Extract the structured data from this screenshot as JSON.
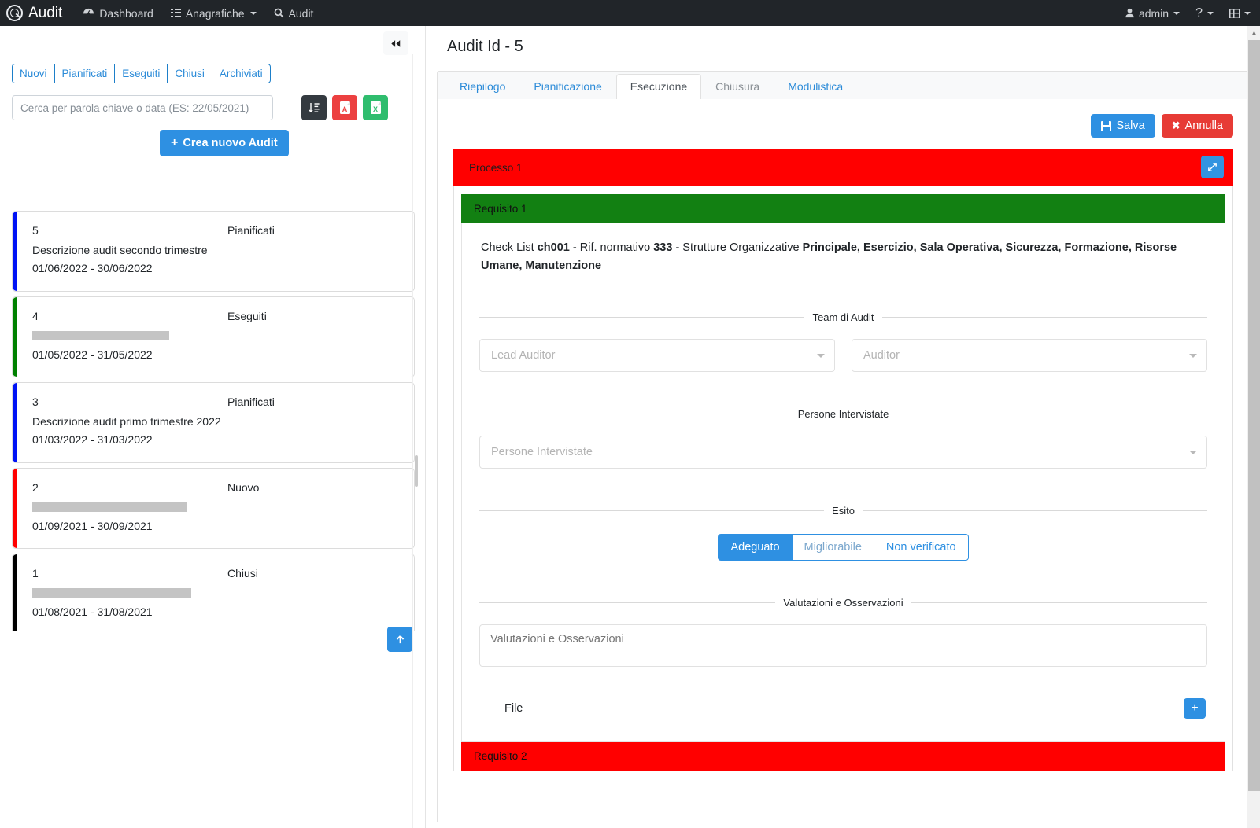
{
  "navbar": {
    "brand": "Audit",
    "brand_icon": "magnifier-logo-icon",
    "links": [
      {
        "label": "Dashboard",
        "icon": "dashboard-icon"
      },
      {
        "label": "Anagrafiche",
        "icon": "list-icon",
        "caret": true
      },
      {
        "label": "Audit",
        "icon": "search-icon"
      }
    ],
    "user": "admin",
    "help": "?",
    "apps_icon": "grid-icon"
  },
  "sidebar": {
    "collapse_icon": "double-chevron-left-icon",
    "filters": [
      {
        "label": "Nuovi"
      },
      {
        "label": "Pianificati"
      },
      {
        "label": "Eseguiti"
      },
      {
        "label": "Chiusi"
      },
      {
        "label": "Archiviati"
      }
    ],
    "search": {
      "placeholder": "Cerca per parola chiave o data (ES: 22/05/2021)",
      "value": ""
    },
    "tools": [
      {
        "name": "sort-button",
        "icon": "sort-amount-down-icon"
      },
      {
        "name": "export-pdf-button",
        "icon": "file-pdf-icon",
        "letter": "A"
      },
      {
        "name": "export-excel-button",
        "icon": "file-excel-icon",
        "letter": "X"
      }
    ],
    "create_button": "Crea nuovo Audit",
    "create_button_icon": "plus-icon",
    "scroll_top_icon": "arrow-up-icon",
    "cards": [
      {
        "id": "5",
        "status": "Pianificati",
        "description": "Descrizione audit secondo trimestre",
        "redacted": false,
        "redacted_width": 0,
        "dates": "01/06/2022 - 30/06/2022",
        "stripe": "#0013f5"
      },
      {
        "id": "4",
        "status": "Eseguiti",
        "description": "",
        "redacted": true,
        "redacted_width": 174,
        "dates": "01/05/2022 - 31/05/2022",
        "stripe": "#008000"
      },
      {
        "id": "3",
        "status": "Pianificati",
        "description": "Descrizione audit primo trimestre 2022",
        "redacted": false,
        "redacted_width": 0,
        "dates": "01/03/2022 - 31/03/2022",
        "stripe": "#0013f5"
      },
      {
        "id": "2",
        "status": "Nuovo",
        "description": "",
        "redacted": true,
        "redacted_width": 197,
        "dates": "01/09/2021 - 30/09/2021",
        "stripe": "#ff0000"
      },
      {
        "id": "1",
        "status": "Chiusi",
        "description": "",
        "redacted": true,
        "redacted_width": 202,
        "dates": "01/08/2021 - 31/08/2021",
        "stripe": "#000000"
      }
    ]
  },
  "main": {
    "title": "Audit Id - 5",
    "tabs": [
      {
        "label": "Riepilogo",
        "state": "link"
      },
      {
        "label": "Pianificazione",
        "state": "link"
      },
      {
        "label": "Esecuzione",
        "state": "active"
      },
      {
        "label": "Chiusura",
        "state": "disabled"
      },
      {
        "label": "Modulistica",
        "state": "link"
      }
    ],
    "actions": {
      "save_label": "Salva",
      "save_icon": "floppy-disk-icon",
      "cancel_label": "Annulla",
      "cancel_icon": "times-icon"
    },
    "processo": {
      "title": "Processo 1",
      "color": "#ff0000",
      "expand_icon": "expand-arrows-icon"
    },
    "requisito": {
      "title": "Requisito 1",
      "color": "#128012",
      "checklist": {
        "prefix": "Check List ",
        "code": "ch001",
        "mid1": " - Rif. normativo ",
        "norm": "333",
        "mid2": " - Strutture Organizzative ",
        "orgs": "Principale, Esercizio, Sala Operativa, Sicurezza, Formazione, Risorse Umane, Manutenzione"
      },
      "team_legend": "Team di Audit",
      "lead_auditor_placeholder": "Lead Auditor",
      "auditor_placeholder": "Auditor",
      "persone_legend": "Persone Intervistate",
      "persone_placeholder": "Persone Intervistate",
      "esito_legend": "Esito",
      "esito_options": [
        {
          "label": "Adeguato",
          "state": "active"
        },
        {
          "label": "Migliorabile",
          "state": "muted"
        },
        {
          "label": "Non verificato",
          "state": "normal"
        }
      ],
      "valutazioni_legend": "Valutazioni e Osservazioni",
      "valutazioni_placeholder": "Valutazioni e Osservazioni",
      "file_label": "File",
      "file_add_icon": "plus-icon"
    },
    "requisito2": {
      "title": "Requisito 2",
      "color": "#ff0000"
    }
  }
}
